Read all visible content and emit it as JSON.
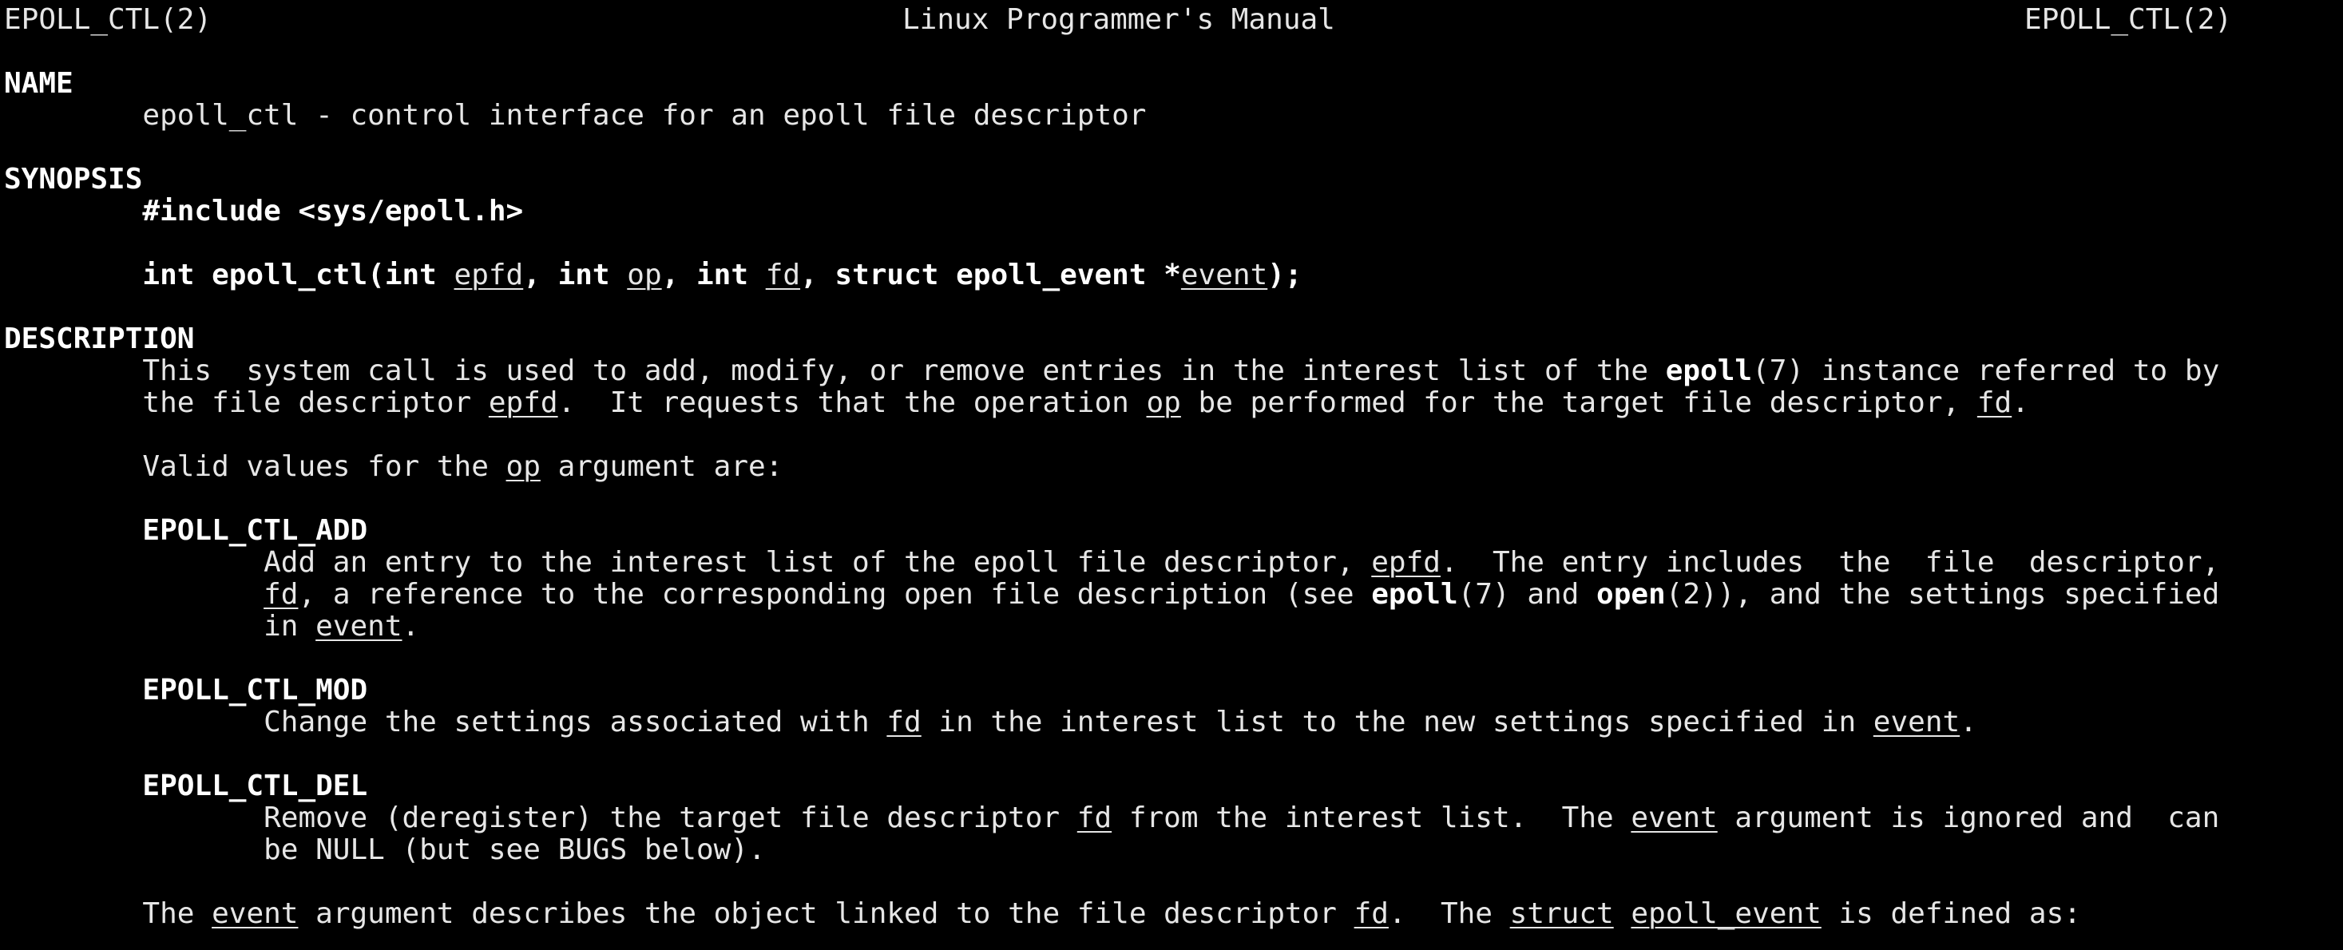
{
  "header": {
    "left": "EPOLL_CTL(2)",
    "center": "Linux Programmer's Manual",
    "right": "EPOLL_CTL(2)"
  },
  "name_section": {
    "heading": "NAME",
    "text": "epoll_ctl - control interface for an epoll file descriptor"
  },
  "synopsis": {
    "heading": "SYNOPSIS",
    "include": "#include <sys/epoll.h>",
    "proto": {
      "p1": "int epoll_ctl(int ",
      "epfd": "epfd",
      "p2": ", int ",
      "op": "op",
      "p3": ", int ",
      "fd": "fd",
      "p4": ", struct epoll_event *",
      "event": "event",
      "p5": ");"
    }
  },
  "description": {
    "heading": "DESCRIPTION",
    "para1": {
      "l1_a": "This  system call is used to add, modify, or remove entries in the interest list of the ",
      "l1_epoll": "epoll",
      "l1_b": "(7) instance referred to by",
      "l2_a": "the file descriptor ",
      "l2_epfd": "epfd",
      "l2_b": ".  It requests that the operation ",
      "l2_op": "op",
      "l2_c": " be performed for the target file descriptor, ",
      "l2_fd": "fd",
      "l2_d": "."
    },
    "valid": {
      "a": "Valid values for the ",
      "op": "op",
      "b": " argument are:"
    },
    "add": {
      "term": "EPOLL_CTL_ADD",
      "l1_a": "Add an entry to the interest list of the epoll file descriptor, ",
      "l1_epfd": "epfd",
      "l1_b": ".  The entry includes  the  file  descriptor,",
      "l2_fd": "fd",
      "l2_a": ", a reference to the corresponding open file description (see ",
      "l2_epoll": "epoll",
      "l2_b": "(7) and ",
      "l2_open": "open",
      "l2_c": "(2)), and the settings specified",
      "l3_a": "in ",
      "l3_event": "event",
      "l3_b": "."
    },
    "mod": {
      "term": "EPOLL_CTL_MOD",
      "l1_a": "Change the settings associated with ",
      "l1_fd": "fd",
      "l1_b": " in the interest list to the new settings specified in ",
      "l1_event": "event",
      "l1_c": "."
    },
    "del": {
      "term": "EPOLL_CTL_DEL",
      "l1_a": "Remove (deregister) the target file descriptor ",
      "l1_fd": "fd",
      "l1_b": " from the interest list.  The ",
      "l1_event": "event",
      "l1_c": " argument is ignored and  can",
      "l2": "be NULL (but see BUGS below)."
    },
    "last": {
      "a": "The ",
      "event": "event",
      "b": " argument describes the object linked to the file descriptor ",
      "fd": "fd",
      "c": ".  The ",
      "struct": "struct",
      "d": " ",
      "epoll_event": "epoll_event",
      "e": " is defined as:"
    }
  },
  "colors": {
    "background": "#000000",
    "foreground": "#e6e6e6",
    "bold": "#ffffff"
  }
}
